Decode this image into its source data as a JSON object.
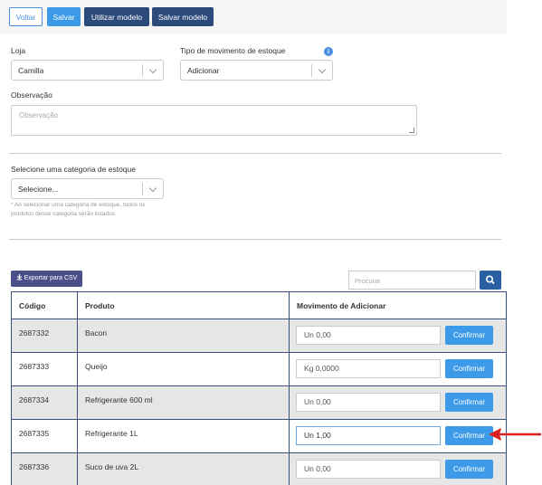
{
  "toolbar": {
    "voltar": "Voltar",
    "salvar": "Salvar",
    "utilizar_modelo": "Utilizar modelo",
    "salvar_modelo": "Salvar modelo"
  },
  "form": {
    "loja_label": "Loja",
    "loja_value": "Camilla",
    "tipo_label": "Tipo de movimento de estoque",
    "tipo_value": "Adicionar",
    "observacao_label": "Observação",
    "observacao_placeholder": "Observação",
    "categoria_label": "Selecione uma categoria de estoque",
    "categoria_value": "Selecione...",
    "categoria_note": "* Ao selecionar uma categoria de estoque, todos os produtos desse categoria serão listados."
  },
  "actions": {
    "export_label": "Exportar para CSV",
    "search_placeholder": "Procurar"
  },
  "table": {
    "headers": {
      "codigo": "Código",
      "produto": "Produto",
      "movimento": "Movimento de Adicionar"
    },
    "confirm_label": "Confirmar",
    "rows": [
      {
        "codigo": "2687332",
        "produto": "Bacon",
        "movimento": "Un 0,00"
      },
      {
        "codigo": "2687333",
        "produto": "Queijo",
        "movimento": "Kg 0,0000"
      },
      {
        "codigo": "2687334",
        "produto": "Refrigerante 600 ml",
        "movimento": "Un 0,00"
      },
      {
        "codigo": "2687335",
        "produto": "Refrigerante 1L",
        "movimento": "Un 1,00"
      },
      {
        "codigo": "2687336",
        "produto": "Suco de uva 2L",
        "movimento": "Un 0,00"
      }
    ]
  },
  "colors": {
    "accent": "#3d9ae8",
    "dark_button": "#2c4a7a",
    "arrow": "#e02020"
  }
}
